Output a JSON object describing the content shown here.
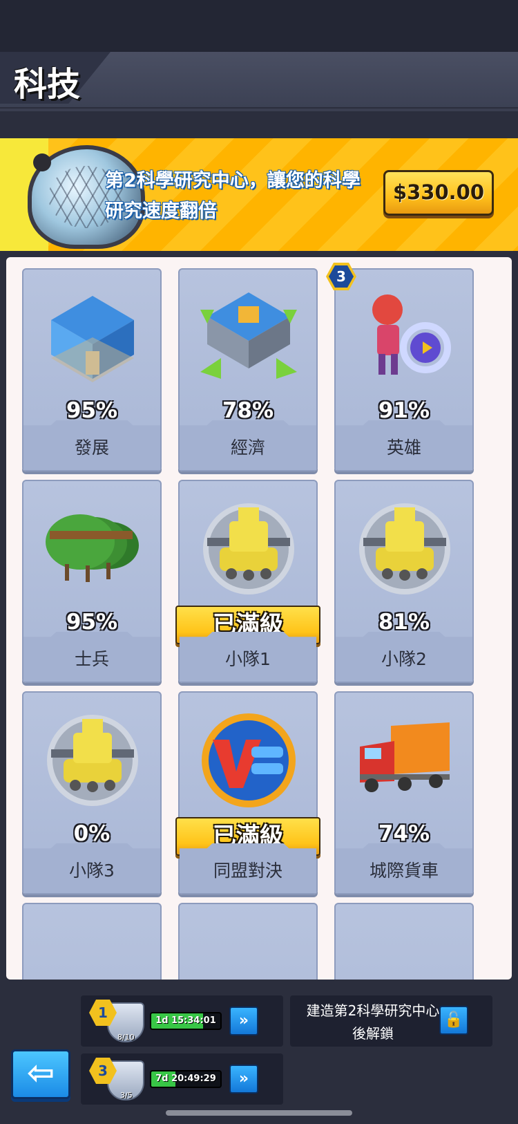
{
  "header": {
    "title": "科技"
  },
  "banner": {
    "text": "第2科學研究中心，讓您的科學研究速度翻倍",
    "price": "$330.00"
  },
  "cards": [
    {
      "label": "發展",
      "percent": "95%",
      "icon": "building-icon"
    },
    {
      "label": "經濟",
      "percent": "78%",
      "icon": "economy-building-icon"
    },
    {
      "label": "英雄",
      "percent": "91%",
      "icon": "hero-icon",
      "badge": "3"
    },
    {
      "label": "士兵",
      "percent": "95%",
      "icon": "soldier-helmet-icon"
    },
    {
      "label": "小隊1",
      "status": "已滿級",
      "icon": "tank-icon"
    },
    {
      "label": "小隊2",
      "percent": "81%",
      "icon": "tank-icon"
    },
    {
      "label": "小隊3",
      "percent": "0%",
      "icon": "tank-icon"
    },
    {
      "label": "同盟對決",
      "status": "已滿級",
      "icon": "vs-icon"
    },
    {
      "label": "城際貨車",
      "percent": "74%",
      "icon": "truck-icon"
    }
  ],
  "queues": [
    {
      "level": "1",
      "count": "8/10",
      "timer": "1d 15:34:01",
      "progress": 0.75
    },
    {
      "level": "3",
      "count": "3/5",
      "timer": "7d 20:49:29",
      "progress": 0.35
    }
  ],
  "unlock": {
    "text": "建造第2科學研究中心後解鎖"
  },
  "colors": {
    "accent": "#ffc01c",
    "card": "#b7c3de",
    "button": "#1b8be6",
    "progress": "#38c646"
  }
}
